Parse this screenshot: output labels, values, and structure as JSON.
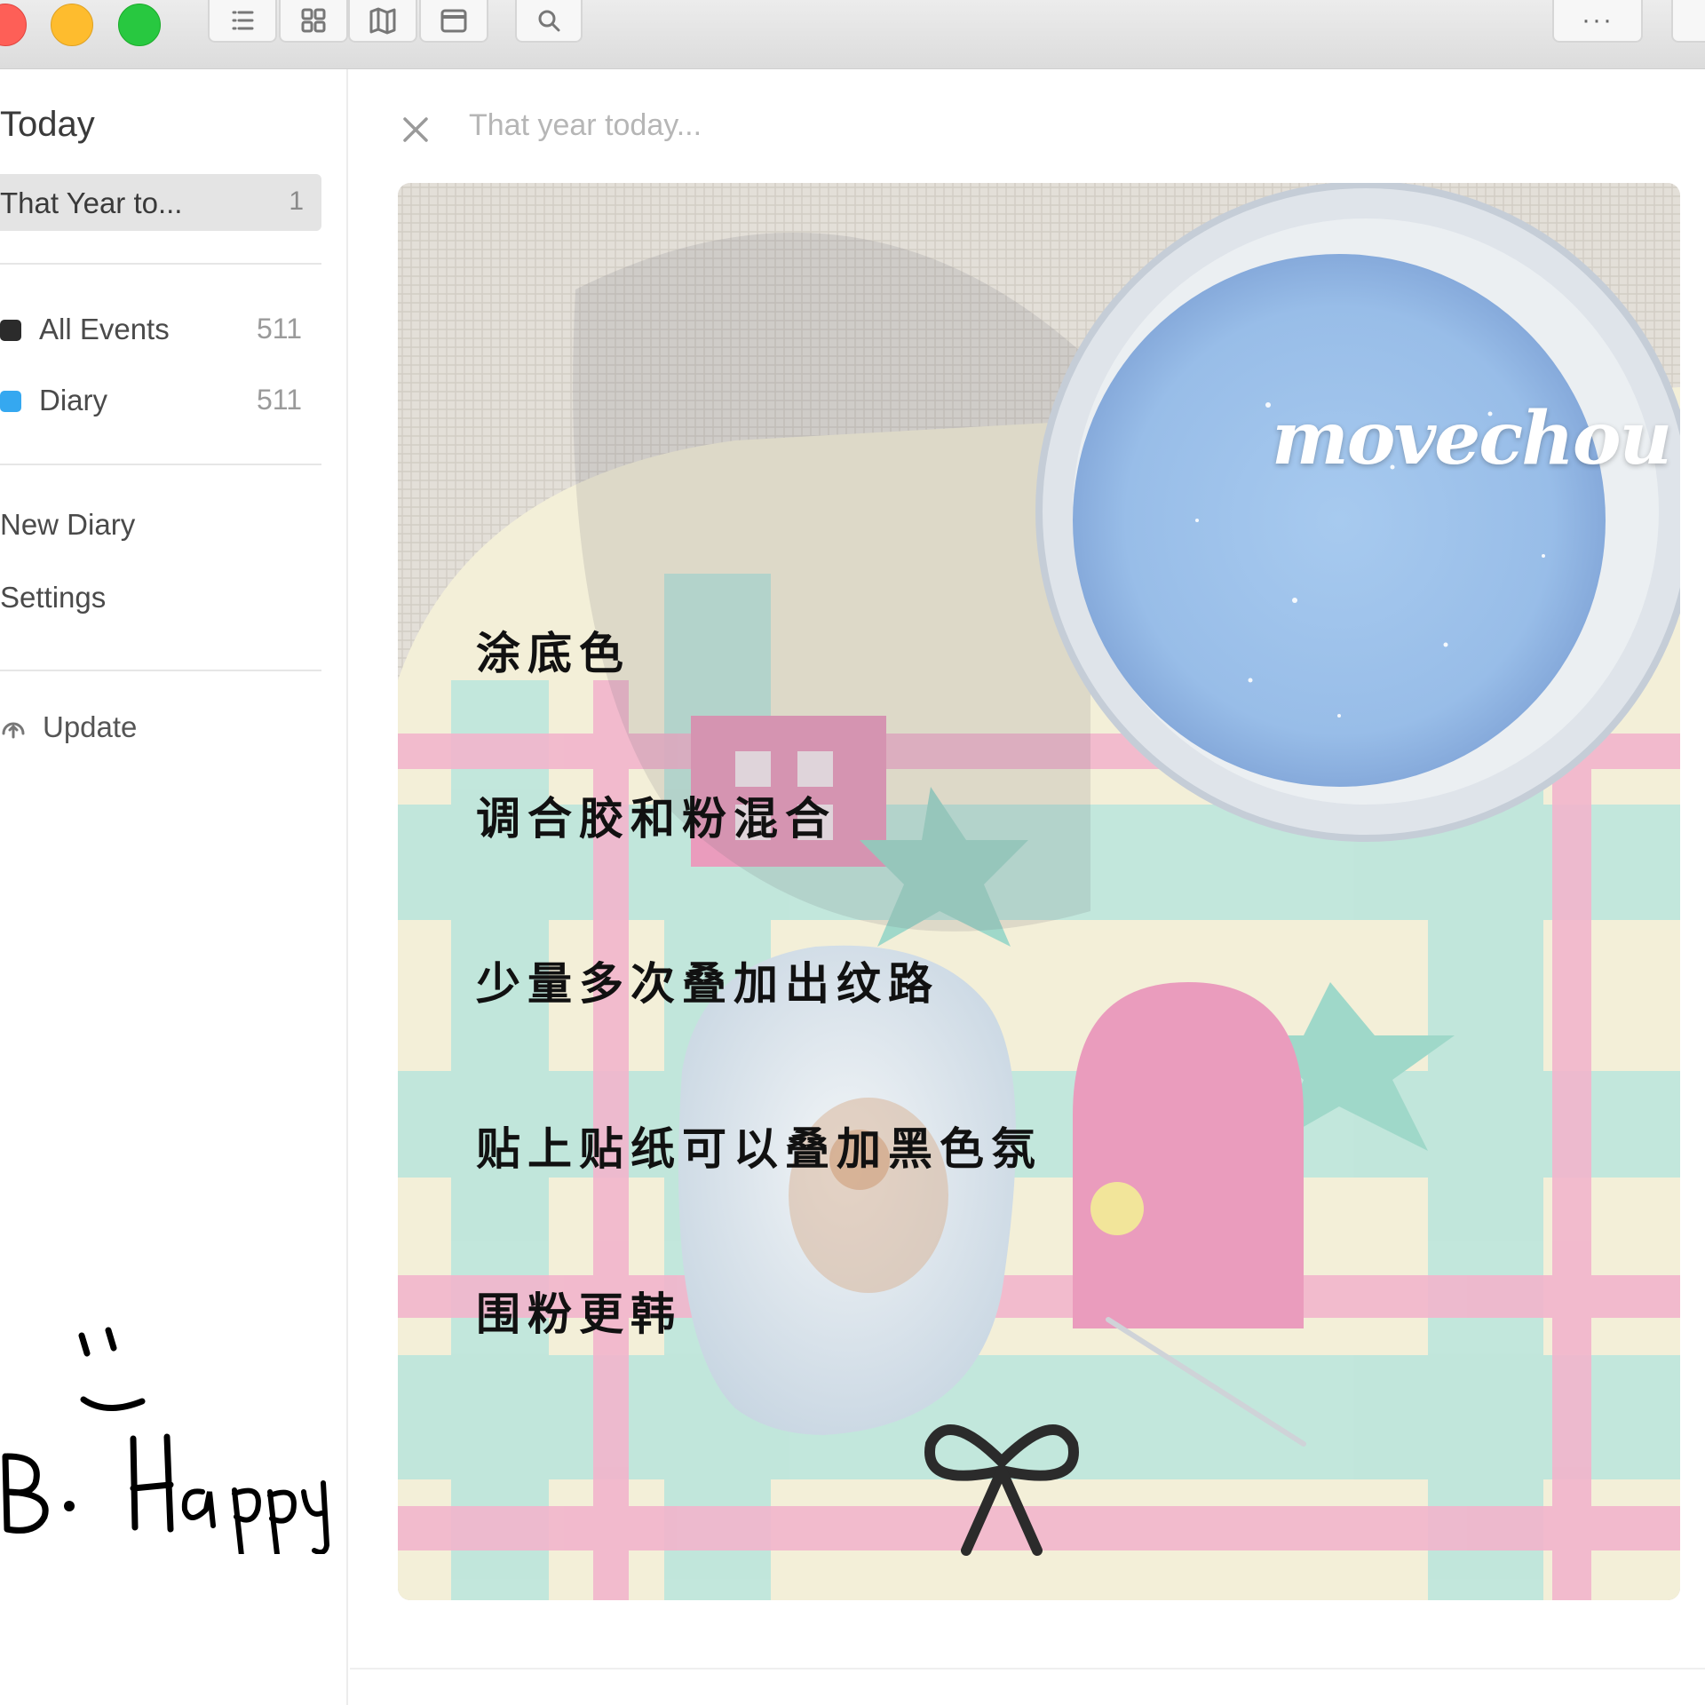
{
  "sidebar": {
    "title": "Today",
    "selected": {
      "label": "That Year to...",
      "count": "1"
    },
    "items": [
      {
        "label": "All Events",
        "count": "511",
        "color": "#2b2b2b"
      },
      {
        "label": "Diary",
        "count": "511",
        "color": "#35a8f0"
      }
    ],
    "links": [
      "New Diary",
      "Settings"
    ],
    "update_label": "Update"
  },
  "toolbar": {
    "buttons": [
      "list-icon",
      "grid-icon",
      "map-icon",
      "calendar-icon",
      "search-icon"
    ],
    "more_label": "···"
  },
  "entry": {
    "title": "That year today...",
    "caption_lines": [
      "涂底色",
      "调合胶和粉混合",
      "少量多次叠加出纹路",
      "贴上贴纸可以叠加黑色氛",
      "围粉更韩"
    ],
    "watermark": "movechou"
  },
  "doodle": {
    "text": "Be Happy"
  },
  "colors": {
    "accent_blue": "#35a8f0",
    "glitter": "#9ec6ee",
    "pink": "#f2b5cc",
    "mint": "#bfe6dc"
  }
}
